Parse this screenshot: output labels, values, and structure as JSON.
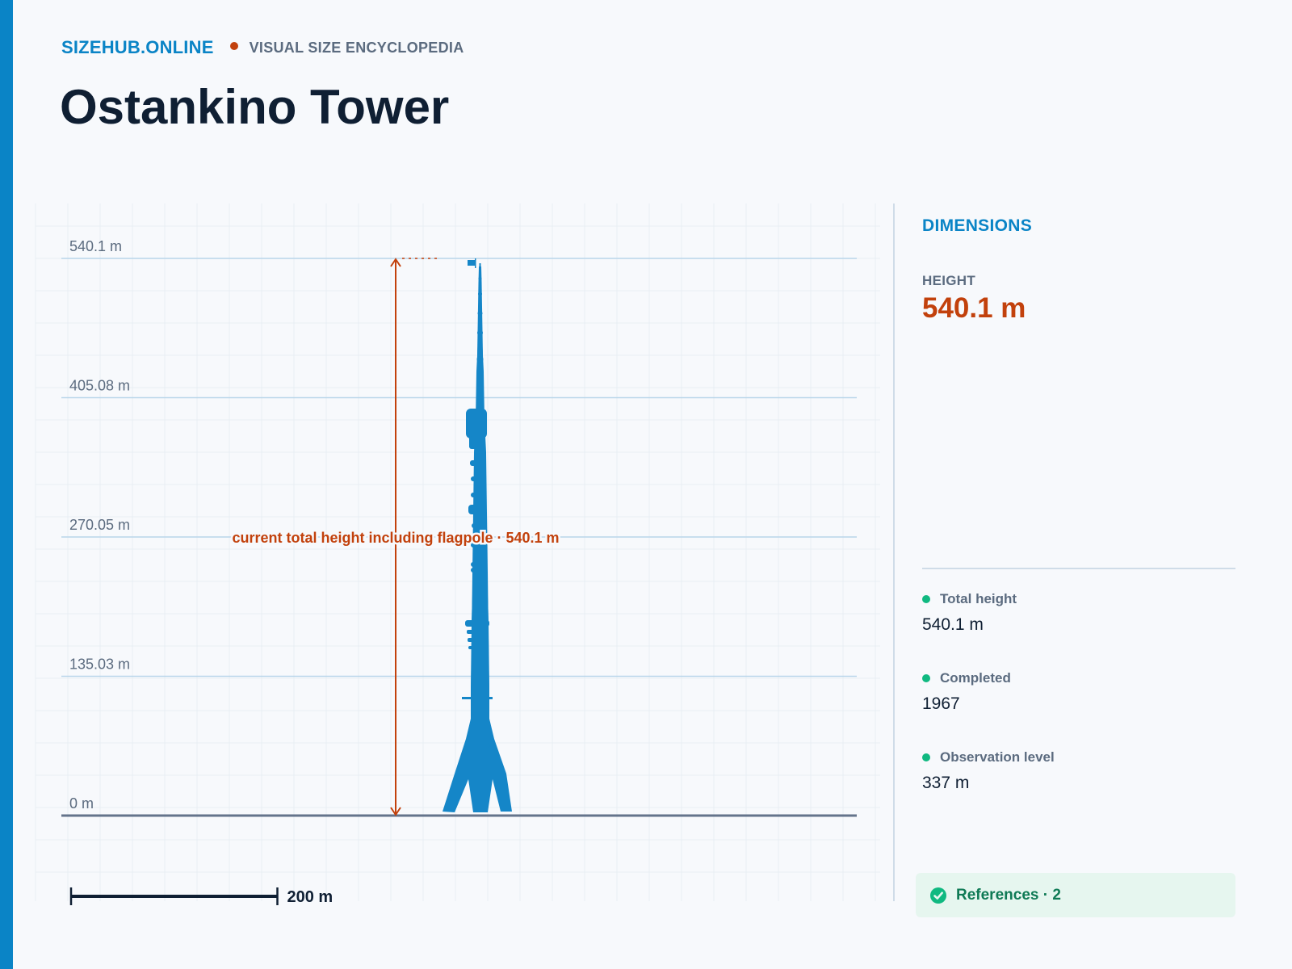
{
  "header": {
    "brand": "SIZEHUB.ONLINE",
    "tagline": "VISUAL SIZE ENCYCLOPEDIA",
    "title": "Ostankino Tower"
  },
  "colors": {
    "accent": "#0a84c6",
    "highlight": "#c2410c",
    "positive": "#10b981",
    "tower": "#1586c8"
  },
  "chart_data": {
    "type": "bar",
    "categories": [
      "Ostankino Tower"
    ],
    "values": [
      540.1
    ],
    "unit": "m",
    "ylim": [
      0,
      540.1
    ],
    "y_ticks": [
      0,
      135.03,
      270.05,
      405.08,
      540.1
    ],
    "y_tick_labels": [
      "0 m",
      "135.03 m",
      "270.05 m",
      "405.08 m",
      "540.1 m"
    ],
    "annotation": "current total height including flagpole · 540.1 m",
    "scale_bar": {
      "value": 200,
      "label": "200 m"
    },
    "grid": true
  },
  "panel": {
    "title": "DIMENSIONS",
    "height_label": "HEIGHT",
    "height_value": "540.1 m",
    "stats": [
      {
        "label": "Total height",
        "value": "540.1 m"
      },
      {
        "label": "Completed",
        "value": "1967"
      },
      {
        "label": "Observation level",
        "value": "337 m"
      }
    ],
    "references": "References · 2",
    "references_icon": "check-circle-icon"
  }
}
